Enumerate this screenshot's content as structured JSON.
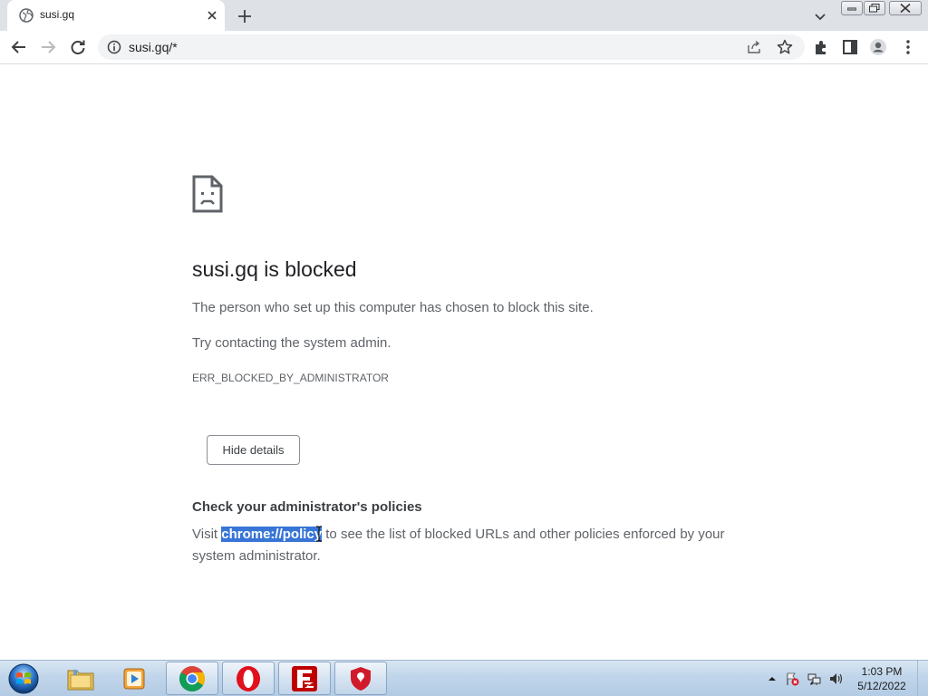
{
  "browser": {
    "tab": {
      "title": "susi.gq"
    },
    "address": {
      "url": "susi.gq/*"
    }
  },
  "page": {
    "title": "susi.gq is blocked",
    "line1": "The person who set up this computer has chosen to block this site.",
    "line2": "Try contacting the system admin.",
    "error_code": "ERR_BLOCKED_BY_ADMINISTRATOR",
    "details_button": "Hide details",
    "policy_heading": "Check your administrator's policies",
    "policy_prefix": "Visit ",
    "policy_link": "chrome://policy",
    "policy_suffix": " to see the list of blocked URLs and other policies enforced by your system administrator."
  },
  "taskbar": {
    "apps": [
      "file-explorer",
      "media-player",
      "chrome",
      "opera",
      "filezilla",
      "security-shield"
    ],
    "clock": {
      "time": "1:03 PM",
      "date": "5/12/2022"
    }
  },
  "colors": {
    "selection": "#3875d7",
    "tabstrip": "#dee1e6",
    "text_primary": "#202124",
    "text_secondary": "#5f6368"
  }
}
